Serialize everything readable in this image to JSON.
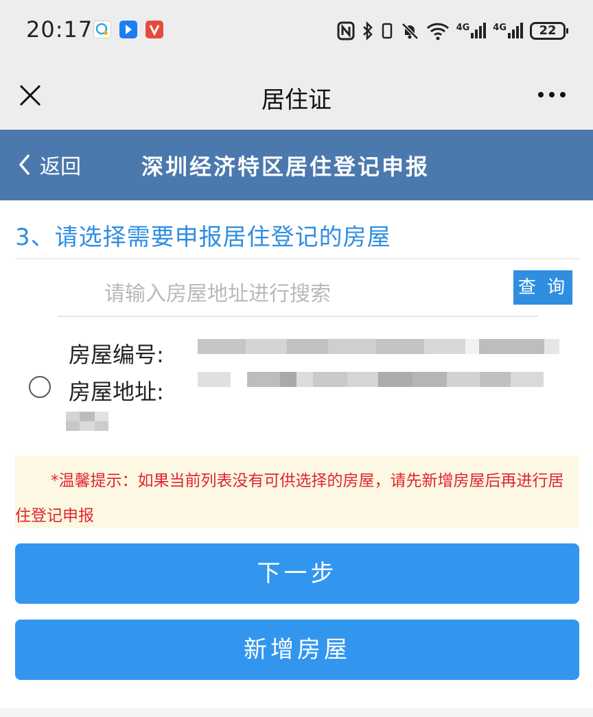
{
  "status_bar": {
    "time": "20:17",
    "battery": "22",
    "network_label_1": "4G",
    "network_label_2": "4G",
    "icons": [
      "nfc-icon",
      "bluetooth-icon",
      "vibrate-icon",
      "mute-icon",
      "wifi-icon",
      "signal-icon",
      "signal-icon",
      "battery-icon"
    ],
    "app_icons": [
      "chat-app-icon",
      "blue-app-icon",
      "red-app-icon"
    ]
  },
  "titlebar": {
    "title": "居住证"
  },
  "header": {
    "back_label": "返回",
    "title": "深圳经济特区居住登记申报",
    "background": "#4c79ad"
  },
  "content": {
    "section_title": "3、请选择需要申报居住登记的房屋",
    "search": {
      "placeholder": "请输入房屋地址进行搜索",
      "value": "",
      "button_label": "查 询"
    },
    "house": {
      "number_label": "房屋编号:",
      "address_label": "房屋地址:",
      "number_value_redacted": true,
      "address_value_redacted": true
    },
    "notice": "*温馨提示：如果当前列表没有可供选择的房屋，请先新增房屋后再进行居住登记申报"
  },
  "buttons": {
    "next": "下一步",
    "add_house": "新增房屋",
    "color": "#3296ef"
  },
  "colors": {
    "accent": "#2f8ee0",
    "notice_text": "#e0252b",
    "notice_bg": "#fdf8e4"
  }
}
